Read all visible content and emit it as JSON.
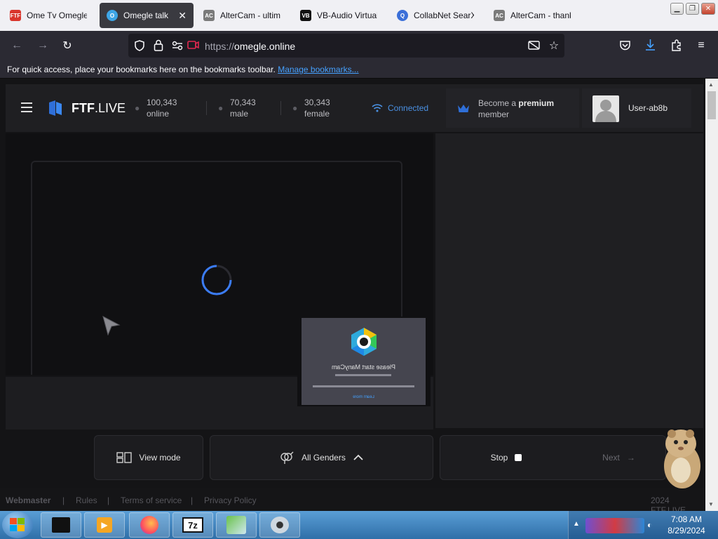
{
  "browser": {
    "tabs": [
      {
        "title": "Ome Tv Omegle",
        "favicon_text": "FTF",
        "favicon_color": "#d9352c"
      },
      {
        "title": "Omegle talk to",
        "favicon_text": "O",
        "favicon_color": "#3ea6e6",
        "active": true
      },
      {
        "title": "AlterCam - ultima",
        "favicon_text": "AC",
        "favicon_color": "#7a7a7a"
      },
      {
        "title": "VB-Audio Virtual",
        "favicon_text": "VB",
        "favicon_color": "#111111"
      },
      {
        "title": "CollabNet SearXN",
        "favicon_text": "Q",
        "favicon_color": "#3b6fd8"
      },
      {
        "title": "AlterCam - thank",
        "favicon_text": "AC",
        "favicon_color": "#7a7a7a"
      }
    ],
    "url_protocol": "https://",
    "url_host": "omegle.online",
    "bookmarks_text": "For quick access, place your bookmarks here on the bookmarks toolbar.",
    "bookmarks_link": "Manage bookmarks..."
  },
  "site": {
    "logo": "FTF",
    "logo_suffix": ".LIVE",
    "stats": [
      {
        "value": "100,343",
        "label": "online"
      },
      {
        "value": "70,343",
        "label": "male"
      },
      {
        "value": "30,343",
        "label": "female"
      }
    ],
    "status": "Connected",
    "premium_text": "Become a",
    "premium_bold": "premium",
    "premium_line2": "member",
    "username": "User-ab8b",
    "popup_text": "Please start ManyCam",
    "popup_link": "Learn more",
    "controls": {
      "view_mode": "View mode",
      "genders": "All Genders",
      "stop": "Stop",
      "next": "Next"
    },
    "footer": {
      "links": [
        "Webmaster",
        "Rules",
        "Terms of service",
        "Privacy Policy"
      ],
      "copyright": "2024 FTF.LIVE"
    }
  },
  "taskbar": {
    "time": "7:08 AM",
    "date": "8/29/2024",
    "apps": [
      "file-manager",
      "media-player",
      "firefox",
      "7zip",
      "installer",
      "webcam"
    ]
  },
  "colors": {
    "accent": "#3b7cf5",
    "connected": "#4a90e2",
    "brand_blue": "#2f6fd8"
  }
}
